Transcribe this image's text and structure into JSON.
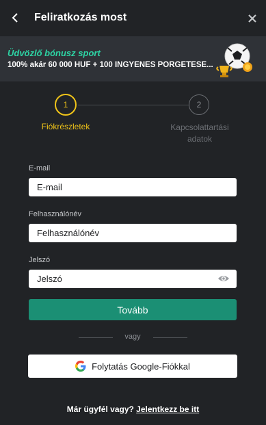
{
  "header": {
    "title": "Feliratkozás most",
    "back_icon": "chevron-left-icon",
    "close_icon": "close-icon"
  },
  "promo": {
    "title": "Üdvözlő bónusz sport",
    "subtitle": "100% akár 60 000 HUF + 100 INGYENES PÖRGETÉSE...",
    "image": "soccer-ball-trophy-illustration"
  },
  "stepper": {
    "steps": [
      {
        "number": "1",
        "label": "Fiókrészletek",
        "active": true
      },
      {
        "number": "2",
        "label": "Kapcsolattartási adatok",
        "active": false
      }
    ]
  },
  "form": {
    "email": {
      "label": "E-mail",
      "placeholder": "E-mail"
    },
    "username": {
      "label": "Felhasználónév",
      "placeholder": "Felhasználónév"
    },
    "password": {
      "label": "Jelszó",
      "placeholder": "Jelszó",
      "toggle_icon": "eye-icon"
    },
    "continue_label": "Tovább"
  },
  "divider": {
    "text": "vagy"
  },
  "google": {
    "label": "Folytatás Google-Fiókkal",
    "icon": "google-icon"
  },
  "footer": {
    "prompt": "Már ügyfél vagy?",
    "login_link": "Jelentkezz be itt"
  },
  "colors": {
    "background": "#212326",
    "promo_background": "#2f3237",
    "accent_green": "#2dd4a4",
    "button_green": "#1b8f74",
    "active_step": "#f0c419"
  }
}
